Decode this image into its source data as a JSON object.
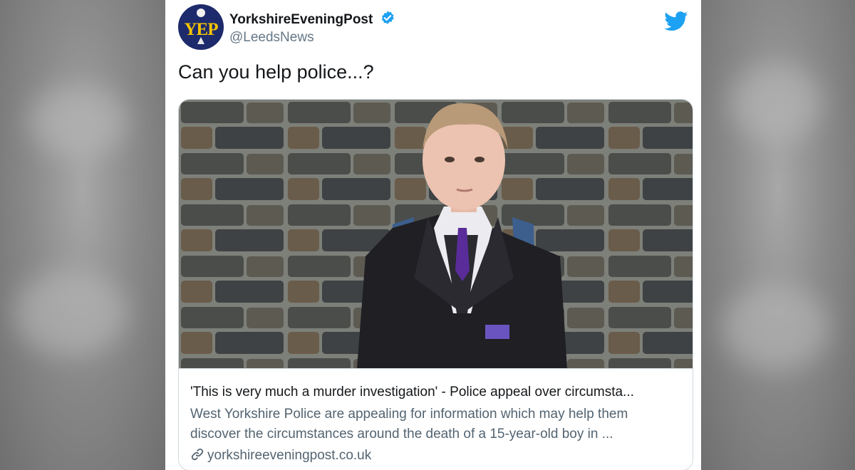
{
  "account": {
    "display_name": "YorkshireEveningPost",
    "handle": "@LeedsNews",
    "avatar_text": "YEP",
    "verified": true
  },
  "tweet": {
    "text": "Can you help police...?"
  },
  "link_card": {
    "title": "'This is very much a murder investigation' - Police appeal over circumsta...",
    "description": "West Yorkshire Police are appealing for information which may help them discover the circumstances around the death of a 15-year-old boy in ...",
    "domain": "yorkshireeveningpost.co.uk"
  },
  "icons": {
    "verified": "verified-badge-icon",
    "platform": "twitter-bird-icon",
    "link": "link-icon"
  },
  "colors": {
    "twitter_blue": "#1da1f2",
    "avatar_bg": "#1d2a6b",
    "avatar_text": "#f4c400"
  }
}
